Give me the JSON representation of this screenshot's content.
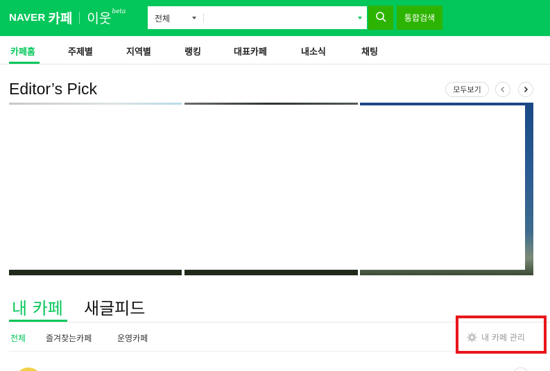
{
  "header": {
    "logo_naver": "NAVER",
    "logo_cafe": "카페",
    "logo_neighbor": "이웃",
    "logo_beta": "beta",
    "search_scope": "전체",
    "search_placeholder": "",
    "total_search_label": "통합검색"
  },
  "nav": {
    "items": [
      {
        "label": "카페홈",
        "active": true
      },
      {
        "label": "주제별"
      },
      {
        "label": "지역별"
      },
      {
        "label": "랭킹"
      },
      {
        "label": "대표카페"
      },
      {
        "label": "내소식"
      },
      {
        "label": "채팅"
      }
    ]
  },
  "editors_pick": {
    "title": "Editor’s Pick",
    "more_label": "모두보기"
  },
  "my_cafe": {
    "tab_my": "내 카페",
    "tab_feed": "새글피드",
    "filters": [
      "전체",
      "즐겨찾는카페",
      "운영카페"
    ],
    "manage_label": "내 카페 관리"
  },
  "colors": {
    "brand_green": "#03c75a",
    "button_green": "#2db400",
    "highlight_red": "#e8161b"
  },
  "icons": [
    "search-icon",
    "caret-down-icon",
    "chevron-left-icon",
    "chevron-right-icon",
    "gear-icon"
  ]
}
